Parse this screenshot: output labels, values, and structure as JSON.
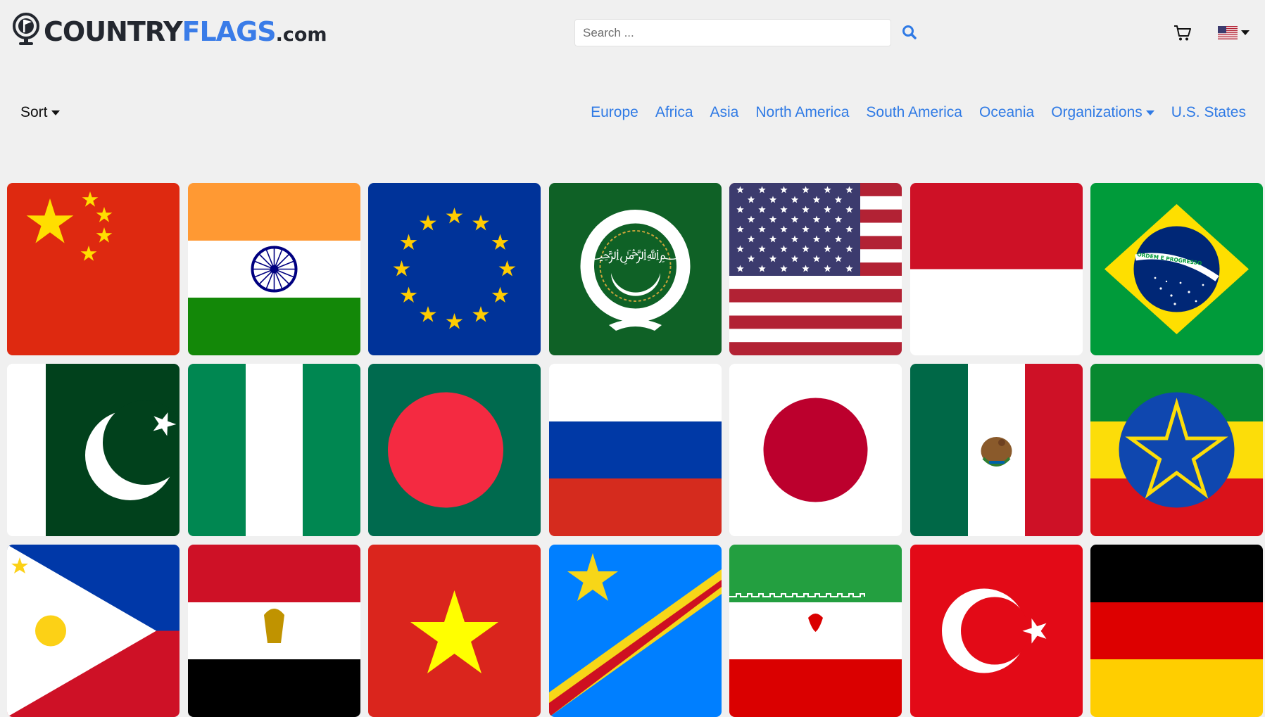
{
  "header": {
    "logo": {
      "part1": "COUNTRY",
      "part2": "FLAGS",
      "part3": ".com"
    },
    "search": {
      "placeholder": "Search ..."
    },
    "icons": {
      "search": "search-icon",
      "cart": "cart-icon",
      "language": "us-flag-icon"
    }
  },
  "sort": {
    "label": "Sort"
  },
  "nav": {
    "items": [
      {
        "label": "Europe"
      },
      {
        "label": "Africa"
      },
      {
        "label": "Asia"
      },
      {
        "label": "North America"
      },
      {
        "label": "South America"
      },
      {
        "label": "Oceania"
      },
      {
        "label": "Organizations",
        "has_dropdown": true
      },
      {
        "label": "U.S. States"
      }
    ],
    "link_color": "#2f7ae5"
  },
  "flags": [
    "china",
    "india",
    "european-union",
    "arab-league",
    "united-states",
    "indonesia",
    "brazil",
    "pakistan",
    "nigeria",
    "bangladesh",
    "russia",
    "japan",
    "mexico",
    "ethiopia",
    "philippines",
    "egypt",
    "vietnam",
    "dr-congo",
    "iran",
    "turkey",
    "germany"
  ],
  "flag_text": {
    "brazil_motto": "ORDEM E PROGRESSO"
  }
}
